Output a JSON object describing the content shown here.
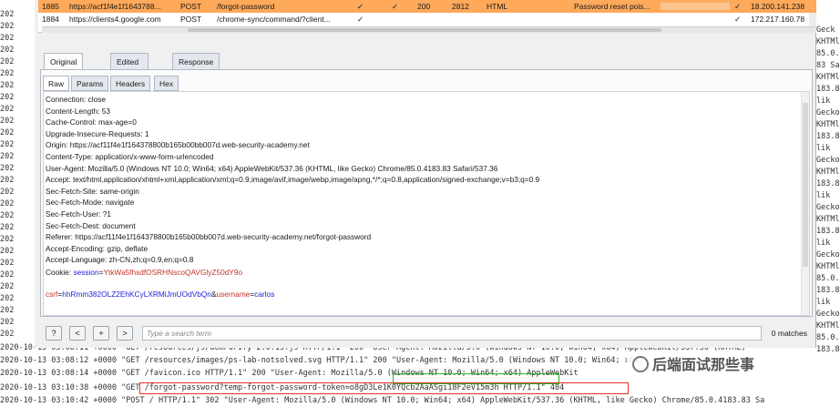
{
  "terminal_bg": {
    "left_prefix": [
      "202",
      "202",
      "202",
      "202",
      "202",
      "202",
      "202",
      "202",
      "202",
      "202",
      "202",
      "202",
      "202",
      "202",
      "202",
      "202",
      "202",
      "202",
      "202",
      "202",
      "202",
      "202",
      "202",
      "202",
      "202",
      "202",
      "202",
      "202"
    ],
    "right_suffix": [
      "Geck",
      "KHTMl",
      "85.0.",
      "83 Sa",
      "KHTMl",
      "183.8",
      "lik",
      "Gecko",
      "KHTMl",
      "183.8",
      "lik",
      "Gecko",
      "KHTMl",
      "183.8",
      "lik",
      "Gecko",
      "KHTMl",
      "183.8",
      "lik",
      "Gecko",
      "KHTMl",
      "85.0.",
      "183.8",
      "lik",
      "Gecko",
      "KHTMl",
      "85.0.",
      "183.8"
    ],
    "log_lines": [
      "2020-10-13 03:08:11 +0000 \"GET /resources/js/domPurify-2.0.15.js HTTP/1.1\" 200 \"User-Agent: Mozilla/5.0 (Windows NT 10.0; Win64; x64) AppleWebKit/537.36 (KHTML,",
      "2020-10-13 03:08:12 +0000 \"GET /resources/images/ps-lab-notsolved.svg HTTP/1.1\" 200 \"User-Agent: Mozilla/5.0 (Windows NT 10.0; Win64; x64)",
      "2020-10-13 03:08:14 +0000 \"GET /favicon.ico HTTP/1.1\" 200 \"User-Agent: Mozilla/5.0 (Windows NT 10.0; Win64; x64) AppleWebKit",
      "2020-10-13 03:10:38 +0000 \"GET /forgot-password?temp-forgot-password-token=o8gD3Le1K0YQcb2AaASgi18F2eV15m3h HTTP/1.1\" 404",
      "2020-10-13 03:10:42 +0000 \"POST / HTTP/1.1\" 302 \"User-Agent: Mozilla/5.0 (Windows NT 10.0; Win64; x64) AppleWebKit/537.36 (KHTML, like Gecko) Chrome/85.0.4183.83 Sa"
    ]
  },
  "history": {
    "rows": [
      {
        "id": "1885",
        "host": "https://acf1f4e1f1643788...",
        "method": "POST",
        "url": "/forgot-password",
        "params": "✓",
        "edited": "✓",
        "status": "200",
        "length": "2812",
        "mime": "HTML",
        "ext": "",
        "title": "Password reset pois...",
        "comment": "",
        "tls": "✓",
        "ip": "18.200.141.238",
        "selected": true
      },
      {
        "id": "1884",
        "host": "https://clients4.google.com",
        "method": "POST",
        "url": "/chrome-sync/command/?client...",
        "params": "✓",
        "edited": "",
        "status": "",
        "length": "",
        "mime": "",
        "ext": "",
        "title": "",
        "comment": "",
        "tls": "✓",
        "ip": "172.217.160.78",
        "selected": false
      }
    ]
  },
  "tabs": [
    "Original request",
    "Edited request",
    "Response"
  ],
  "subtabs": [
    "Raw",
    "Params",
    "Headers",
    "Hex"
  ],
  "request": {
    "headers": [
      "Connection: close",
      "Content-Length: 53",
      "Cache-Control: max-age=0",
      "Upgrade-Insecure-Requests: 1",
      "Origin: https://acf11f4e1f164378800b165b00bb007d.web-security-academy.net",
      "Content-Type: application/x-www-form-urlencoded",
      "User-Agent: Mozilla/5.0 (Windows NT 10.0; Win64; x64) AppleWebKit/537.36 (KHTML, like Gecko) Chrome/85.0.4183.83 Safari/537.36",
      "Accept: text/html,application/xhtml+xml,application/xml;q=0.9,image/avif,image/webp,image/apng,*/*;q=0.8,application/signed-exchange;v=b3;q=0.9",
      "Sec-Fetch-Site: same-origin",
      "Sec-Fetch-Mode: navigate",
      "Sec-Fetch-User: ?1",
      "Sec-Fetch-Dest: document",
      "Referer: https://acf11f4e1f164378800b165b00bb007d.web-security-academy.net/forgot-password",
      "Accept-Encoding: gzip, deflate",
      "Accept-Language: zh-CN,zh;q=0.9,en;q=0.8"
    ],
    "cookie_label": "Cookie: ",
    "cookie_name": "session",
    "cookie_value": "YtkWa5fhsdfOSRHNscoQAVGlyZ50dY9o",
    "body": {
      "csrf_name": "csrf",
      "csrf_value": "hhRmm382OLZ2EhKCyLXRMiJmUOdVbQn",
      "amp": "&",
      "user_name": "username",
      "user_value": "carlos"
    }
  },
  "search": {
    "help_label": "?",
    "prev_label": "<",
    "add_label": "+",
    "next_label": ">",
    "placeholder": "Type a search term",
    "matches": "0 matches"
  },
  "watermark": "后端面试那些事"
}
